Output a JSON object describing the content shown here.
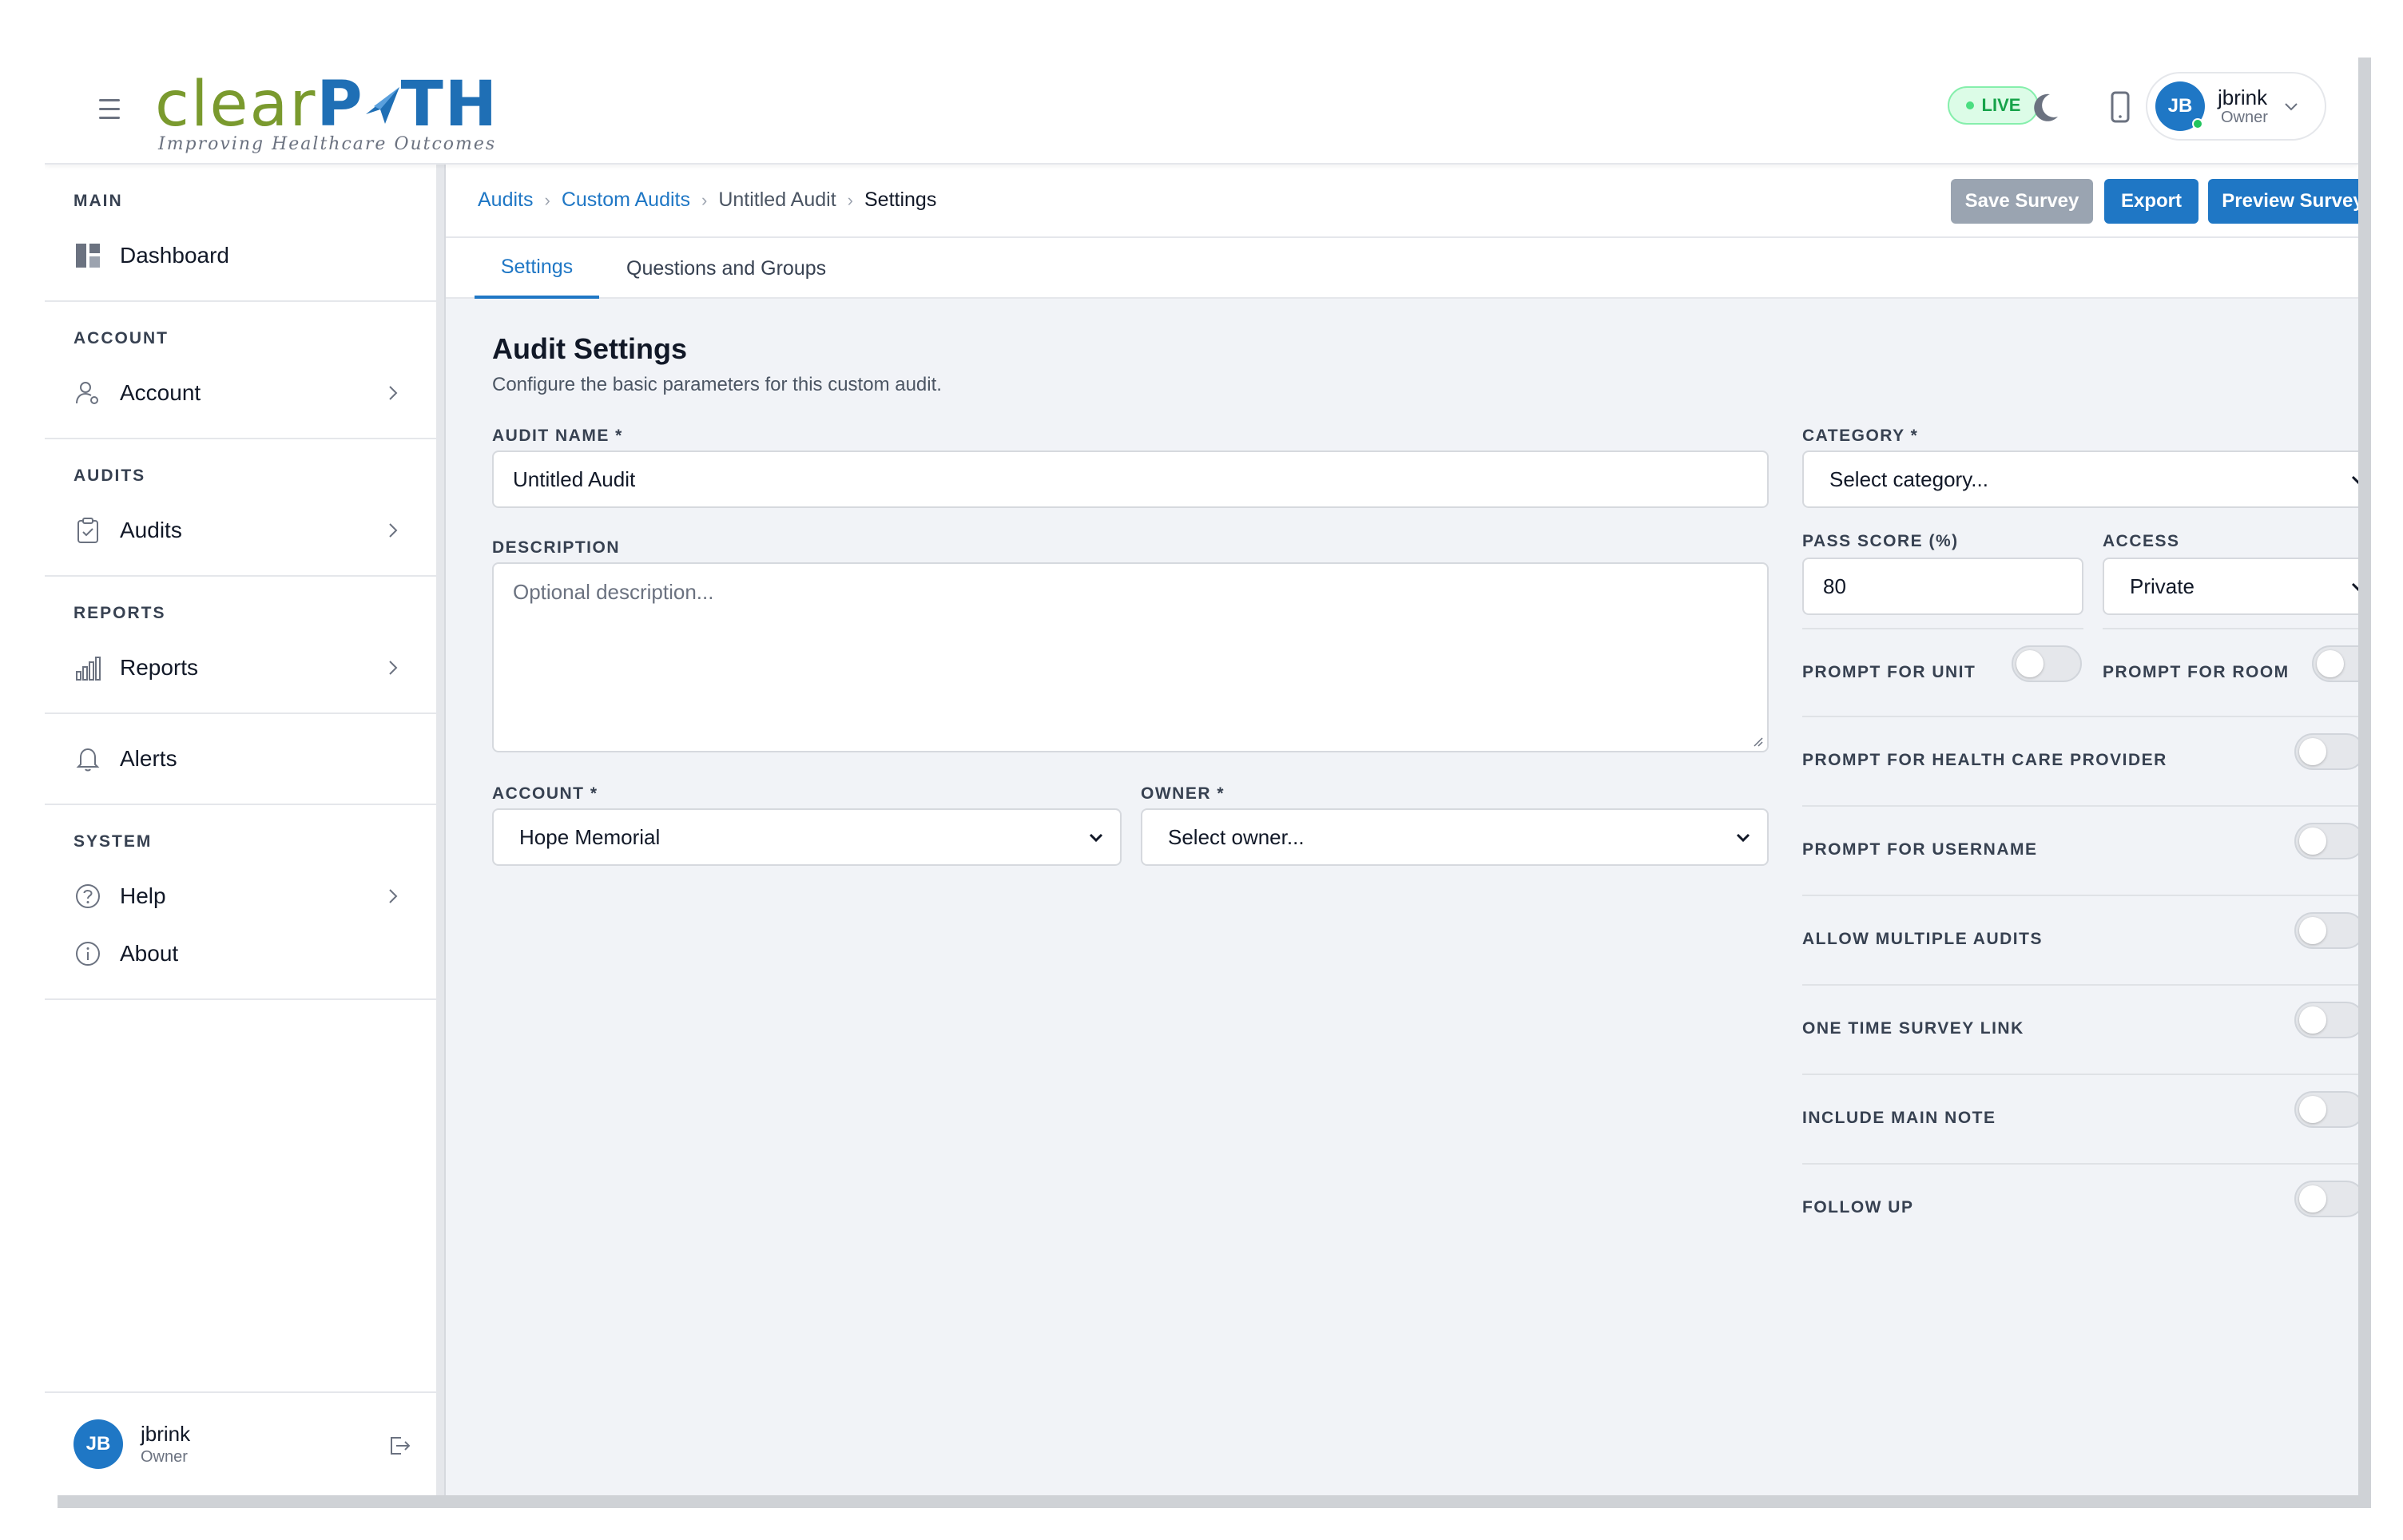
{
  "brand": {
    "word_clear": "clear",
    "word_path": "P",
    "word_path_end": "TH",
    "tagline": "Improving Healthcare Outcomes",
    "primary_color": "#1f77c5",
    "logo_green": "#7a9a2e"
  },
  "header": {
    "live_label": "LIVE",
    "user": {
      "initials": "JB",
      "name": "jbrink",
      "role": "Owner"
    },
    "icons": [
      "menu-icon",
      "moon-icon",
      "mobile-icon",
      "chevron-down-icon"
    ]
  },
  "sidebar": {
    "sections": [
      {
        "title": "MAIN",
        "items": [
          {
            "label": "Dashboard",
            "icon": "dashboard-icon"
          }
        ]
      },
      {
        "title": "ACCOUNT",
        "items": [
          {
            "label": "Account",
            "icon": "user-cog-icon"
          }
        ]
      },
      {
        "title": "AUDITS",
        "items": [
          {
            "label": "Audits",
            "icon": "clipboard-icon"
          }
        ]
      },
      {
        "title": "REPORTS",
        "items": [
          {
            "label": "Reports",
            "icon": "bar-chart-icon"
          },
          {
            "label": "Alerts",
            "icon": "bell-icon"
          }
        ]
      },
      {
        "title": "SYSTEM",
        "items": [
          {
            "label": "Help",
            "icon": "help-icon"
          },
          {
            "label": "About",
            "icon": "info-icon"
          }
        ]
      }
    ],
    "footer": {
      "initials": "JB",
      "name": "jbrink",
      "role": "Owner"
    }
  },
  "breadcrumb": [
    "Audits",
    "Custom Audits",
    "Untitled Audit",
    "Settings"
  ],
  "toolbar": {
    "save_label": "Save Survey",
    "export_label": "Export",
    "preview_label": "Preview Survey"
  },
  "tabs": [
    "Settings",
    "Questions and Groups"
  ],
  "form": {
    "title": "Audit Settings",
    "subtitle": "Configure the basic parameters for this custom audit.",
    "audit_name_label": "AUDIT NAME *",
    "audit_name_value": "Untitled Audit",
    "description_label": "DESCRIPTION",
    "description_placeholder": "Optional description...",
    "account_label": "ACCOUNT *",
    "account_value": "Hope Memorial",
    "owner_label": "OWNER *",
    "owner_value": "Select owner...",
    "category_label": "CATEGORY *",
    "category_value": "Select category...",
    "pass_score_label": "PASS SCORE (%)",
    "pass_score_value": "80",
    "access_label": "ACCESS",
    "access_value": "Private"
  },
  "toggles": [
    {
      "label": "PROMPT FOR UNIT",
      "on": false
    },
    {
      "label": "PROMPT FOR ROOM",
      "on": false
    },
    {
      "label": "PROMPT FOR HEALTH CARE PROVIDER",
      "on": false
    },
    {
      "label": "PROMPT FOR USERNAME",
      "on": false
    },
    {
      "label": "ALLOW MULTIPLE AUDITS",
      "on": false
    },
    {
      "label": "ONE TIME SURVEY LINK",
      "on": false
    },
    {
      "label": "INCLUDE MAIN NOTE",
      "on": false
    },
    {
      "label": "FOLLOW UP",
      "on": false
    }
  ]
}
